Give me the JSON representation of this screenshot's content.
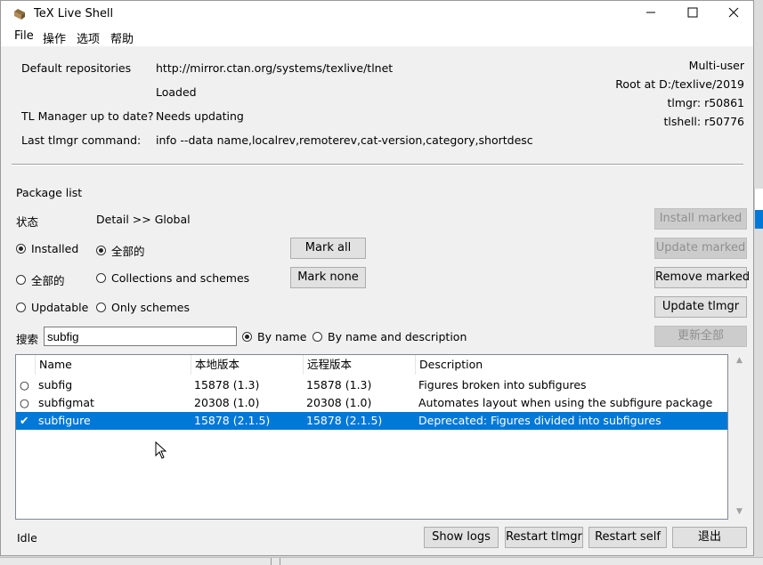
{
  "window": {
    "title": "TeX Live Shell",
    "min": "—",
    "max": "☐",
    "close": "✕"
  },
  "menu": [
    "File",
    "操作",
    "选项",
    "帮助"
  ],
  "info": {
    "repo_label": "Default repositories",
    "repo_value": "http://mirror.ctan.org/systems/texlive/tlnet",
    "loaded": "Loaded",
    "uptodate_label": "TL Manager up to date?",
    "uptodate_value": "Needs updating",
    "lastcmd_label": "Last tlmgr command:",
    "lastcmd_value": "info --data name,localrev,remoterev,cat-version,category,shortdesc",
    "multi_user": "Multi-user",
    "root": "Root at D:/texlive/2019",
    "tlmgr_rev": "tlmgr: r50861",
    "tlshell_rev": "tlshell: r50776"
  },
  "packages": {
    "section_label": "Package list",
    "status_label": "状态",
    "detail_label": "Detail >> Global",
    "filter_status": [
      {
        "label": "Installed",
        "checked": true
      },
      {
        "label": "全部的",
        "checked": false
      },
      {
        "label": "Updatable",
        "checked": false
      }
    ],
    "filter_detail": [
      {
        "label": "全部的",
        "checked": true
      },
      {
        "label": "Collections and schemes",
        "checked": false
      },
      {
        "label": "Only schemes",
        "checked": false
      }
    ],
    "mark_all": "Mark all",
    "mark_none": "Mark none",
    "install_marked": "Install marked",
    "update_marked": "Update marked",
    "remove_marked": "Remove marked",
    "update_tlmgr": "Update tlmgr",
    "update_all": "更新全部",
    "search_label": "搜索",
    "search_value": "subfig",
    "search_by": [
      {
        "label": "By name",
        "checked": true
      },
      {
        "label": "By name and description",
        "checked": false
      }
    ]
  },
  "table": {
    "headers": [
      "Name",
      "本地版本",
      "远程版本",
      "Description"
    ],
    "rows": [
      {
        "mark": "○",
        "name": "subfig",
        "local": "15878 (1.3)",
        "remote": "15878 (1.3)",
        "desc": "Figures broken into subfigures",
        "selected": false
      },
      {
        "mark": "○",
        "name": "subfigmat",
        "local": "20308 (1.0)",
        "remote": "20308 (1.0)",
        "desc": "Automates layout when using the subfigure package",
        "selected": false
      },
      {
        "mark": "✔",
        "name": "subfigure",
        "local": "15878 (2.1.5)",
        "remote": "15878 (2.1.5)",
        "desc": "Deprecated: Figures divided into subfigures",
        "selected": true
      }
    ]
  },
  "footer": {
    "status": "Idle",
    "show_logs": "Show logs",
    "restart_tlmgr": "Restart tlmgr",
    "restart_self": "Restart self",
    "quit": "退出"
  },
  "colors": {
    "selection": "#0078d7",
    "window_bg": "#f0f0f0"
  }
}
